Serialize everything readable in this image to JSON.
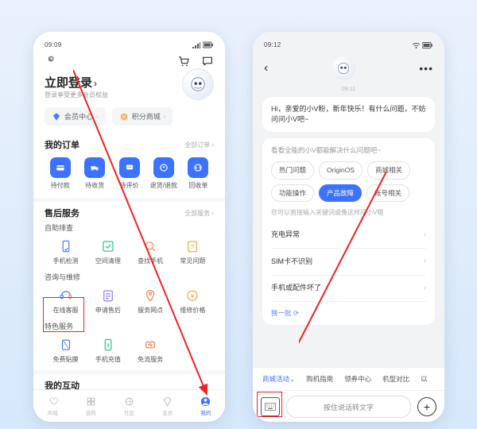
{
  "left": {
    "status": {
      "time": "09:09",
      "icons": "◉ ⟟ ✉ ⋯"
    },
    "header": {
      "login": "立即登录",
      "sub": "登录享受更多会员权益"
    },
    "pills": {
      "member": "会员中心",
      "points": "积分商城"
    },
    "orders": {
      "title": "我的订单",
      "more": "全部订单 ›",
      "items": [
        "待付款",
        "待收货",
        "待评价",
        "退货/退款",
        "回收单"
      ]
    },
    "service": {
      "title": "售后服务",
      "more": "全部服务 ›",
      "g1": {
        "title": "自助排查",
        "items": [
          "手机检测",
          "空间清理",
          "查找手机",
          "常见问题"
        ]
      },
      "g2": {
        "title": "咨询与维修",
        "items": [
          "在线客服",
          "申请售后",
          "服务网点",
          "维修价格"
        ]
      },
      "g3": {
        "title": "特色服务",
        "items": [
          "免费贴膜",
          "手机充值",
          "免流服务"
        ]
      }
    },
    "interact": {
      "title": "我的互动"
    },
    "nav": [
      "商城",
      "选购",
      "社区",
      "会员",
      "我的"
    ]
  },
  "right": {
    "status": {
      "time": "09:12"
    },
    "chat_time": "09:11",
    "greet": "Hi，亲爱的小V粉，新年快乐！有什么问题，不妨问问小V吧~",
    "panel_title": "看看全能的小V都能解决什么问题吧~",
    "chips": [
      "热门问题",
      "OriginOS",
      "商城相关",
      "功能操作",
      "产品故障",
      "帐号相关"
    ],
    "chip_selected": 4,
    "hint": "您可以直接输入关键词或像这样问小V哦",
    "list": [
      "充电异常",
      "SIM卡不识别",
      "手机或配件坏了"
    ],
    "refresh": "换一批 ⟳",
    "ticker": [
      "商城活动⌄",
      "购机指南",
      "领券中心",
      "机型对比",
      "以"
    ],
    "voice_placeholder": "按住说话转文字"
  }
}
